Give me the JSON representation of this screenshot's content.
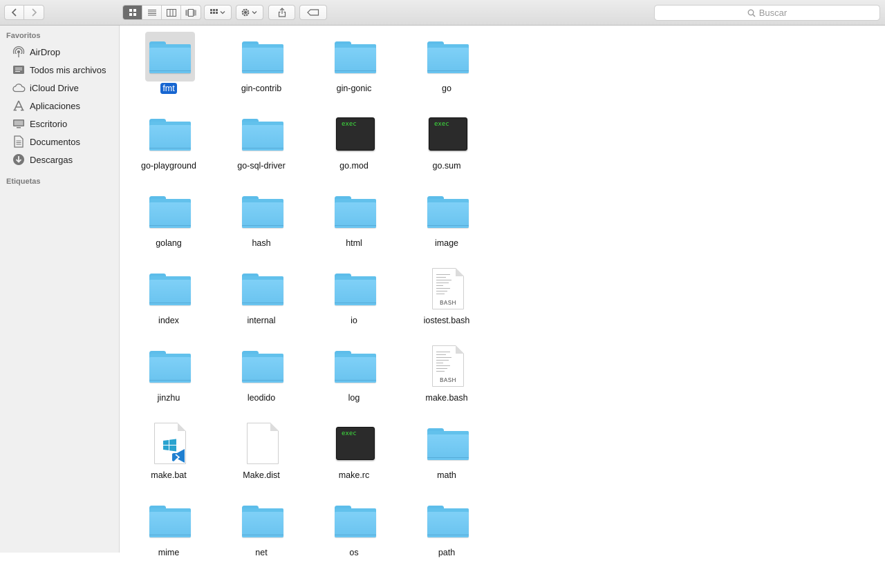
{
  "toolbar": {
    "search_placeholder": "Buscar"
  },
  "sidebar": {
    "favorites_header": "Favoritos",
    "tags_header": "Etiquetas",
    "items": [
      {
        "label": "AirDrop",
        "icon": "airdrop-icon"
      },
      {
        "label": "Todos mis archivos",
        "icon": "all-files-icon"
      },
      {
        "label": "iCloud Drive",
        "icon": "cloud-icon"
      },
      {
        "label": "Aplicaciones",
        "icon": "applications-icon"
      },
      {
        "label": "Escritorio",
        "icon": "desktop-icon"
      },
      {
        "label": "Documentos",
        "icon": "documents-icon"
      },
      {
        "label": "Descargas",
        "icon": "downloads-icon"
      }
    ]
  },
  "files": [
    {
      "name": "fmt",
      "type": "folder",
      "selected": true
    },
    {
      "name": "gin-contrib",
      "type": "folder"
    },
    {
      "name": "gin-gonic",
      "type": "folder"
    },
    {
      "name": "go",
      "type": "folder"
    },
    {
      "name": "go-playground",
      "type": "folder"
    },
    {
      "name": "go-sql-driver",
      "type": "folder"
    },
    {
      "name": "go.mod",
      "type": "exec",
      "badge": "exec"
    },
    {
      "name": "go.sum",
      "type": "exec",
      "badge": "exec"
    },
    {
      "name": "golang",
      "type": "folder"
    },
    {
      "name": "hash",
      "type": "folder"
    },
    {
      "name": "html",
      "type": "folder"
    },
    {
      "name": "image",
      "type": "folder"
    },
    {
      "name": "index",
      "type": "folder"
    },
    {
      "name": "internal",
      "type": "folder"
    },
    {
      "name": "io",
      "type": "folder"
    },
    {
      "name": "iostest.bash",
      "type": "bash",
      "badge": "BASH"
    },
    {
      "name": "jinzhu",
      "type": "folder"
    },
    {
      "name": "leodido",
      "type": "folder"
    },
    {
      "name": "log",
      "type": "folder"
    },
    {
      "name": "make.bash",
      "type": "bash",
      "badge": "BASH"
    },
    {
      "name": "make.bat",
      "type": "bat"
    },
    {
      "name": "Make.dist",
      "type": "blank"
    },
    {
      "name": "make.rc",
      "type": "exec",
      "badge": "exec"
    },
    {
      "name": "math",
      "type": "folder"
    },
    {
      "name": "mime",
      "type": "folder"
    },
    {
      "name": "net",
      "type": "folder"
    },
    {
      "name": "os",
      "type": "folder"
    },
    {
      "name": "path",
      "type": "folder"
    }
  ],
  "colors": {
    "folder": "#6fc7f2",
    "selection": "#1766d1",
    "sidebar_bg": "#f0f0f0"
  }
}
